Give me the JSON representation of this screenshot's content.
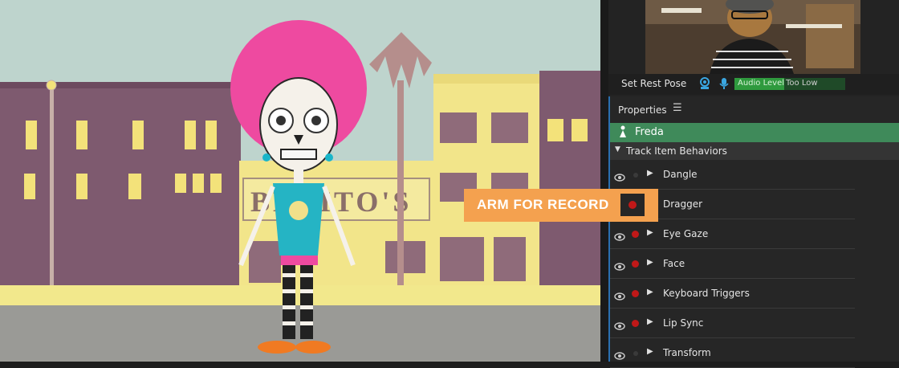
{
  "scene": {
    "storefront_sign": "BENITO'S",
    "character": "Freda"
  },
  "camera_bar": {
    "rest_pose_label": "Set Rest Pose",
    "camera_icon": "webcam-icon",
    "mic_icon": "microphone-icon",
    "audio_level_label": "Audio Level",
    "audio_status": "Too Low"
  },
  "properties": {
    "title": "Properties",
    "menu_icon": "hamburger-menu-icon",
    "puppet_name": "Freda",
    "section_label": "Track Item Behaviors",
    "behaviors": [
      {
        "label": "Dangle",
        "armed": false
      },
      {
        "label": "Dragger",
        "armed": true
      },
      {
        "label": "Eye Gaze",
        "armed": true
      },
      {
        "label": "Face",
        "armed": true
      },
      {
        "label": "Keyboard Triggers",
        "armed": true
      },
      {
        "label": "Lip Sync",
        "armed": true
      },
      {
        "label": "Transform",
        "armed": false
      }
    ]
  },
  "callout": {
    "text": "ARM FOR RECORD"
  },
  "colors": {
    "accent_green": "#3f8a5a",
    "callout_orange": "#f4a14f",
    "record_red": "#c01818",
    "panel_bg": "#262626",
    "focus_blue": "#2a6fb0"
  }
}
